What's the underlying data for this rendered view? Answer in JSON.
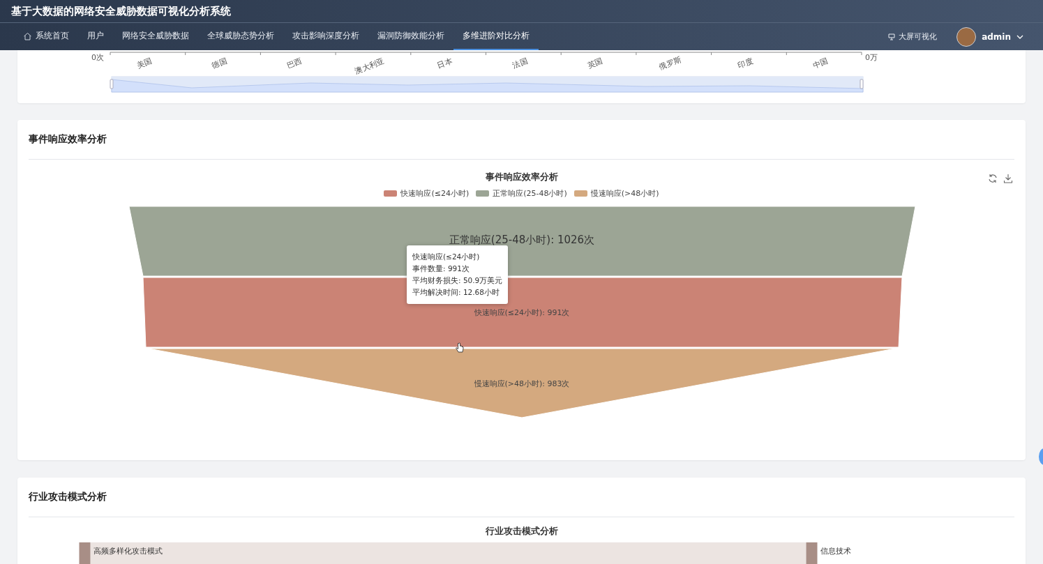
{
  "header": {
    "title": "基于大数据的网络安全威胁数据可视化分析系统",
    "nav": [
      {
        "label": "系统首页",
        "kind": "home",
        "selected": false
      },
      {
        "label": "用户",
        "kind": "plain",
        "selected": false
      },
      {
        "label": "网络安全威胁数据",
        "kind": "plain",
        "selected": false
      },
      {
        "label": "全球威胁态势分析",
        "kind": "plain",
        "selected": false
      },
      {
        "label": "攻击影响深度分析",
        "kind": "plain",
        "selected": false
      },
      {
        "label": "漏洞防御效能分析",
        "kind": "plain",
        "selected": false
      },
      {
        "label": "多维进阶对比分析",
        "kind": "plain",
        "selected": true
      }
    ],
    "big_screen_link": "大屏可视化",
    "user": {
      "name": "admin"
    }
  },
  "top_chart": {
    "axis_start": "0次",
    "axis_end": "0万",
    "categories": [
      "美国",
      "德国",
      "巴西",
      "澳大利亚",
      "日本",
      "法国",
      "英国",
      "俄罗斯",
      "印度",
      "中国"
    ],
    "slider": {
      "level": 1
    }
  },
  "response_card": {
    "title": "事件响应效率分析",
    "chart": {
      "title": "事件响应效率分析",
      "legend": [
        {
          "label": "快速响应(≤24小时)",
          "color": "#cb8375"
        },
        {
          "label": "正常响应(25-48小时)",
          "color": "#9ca595"
        },
        {
          "label": "慢速响应(>48小时)",
          "color": "#d4a97f"
        }
      ],
      "stages": [
        {
          "label": "正常响应(25-48小时): 1026次",
          "color": "#9ca595",
          "emphasized": true
        },
        {
          "label": "快速响应(≤24小时): 991次",
          "color": "#cb8375",
          "emphasized": false
        },
        {
          "label": "慢速响应(>48小时): 983次",
          "color": "#d4a97f",
          "emphasized": false
        }
      ],
      "tooltip": {
        "title": "快速响应(≤24小时)",
        "lines": [
          "事件数量: 991次",
          "平均财务损失: 50.9万美元",
          "平均解决时间: 12.68小时"
        ]
      }
    }
  },
  "industry_card": {
    "title": "行业攻击模式分析",
    "chart": {
      "title": "行业攻击模式分析",
      "source_node": "高频多样化攻击模式",
      "target_node": "信息技术"
    }
  }
}
